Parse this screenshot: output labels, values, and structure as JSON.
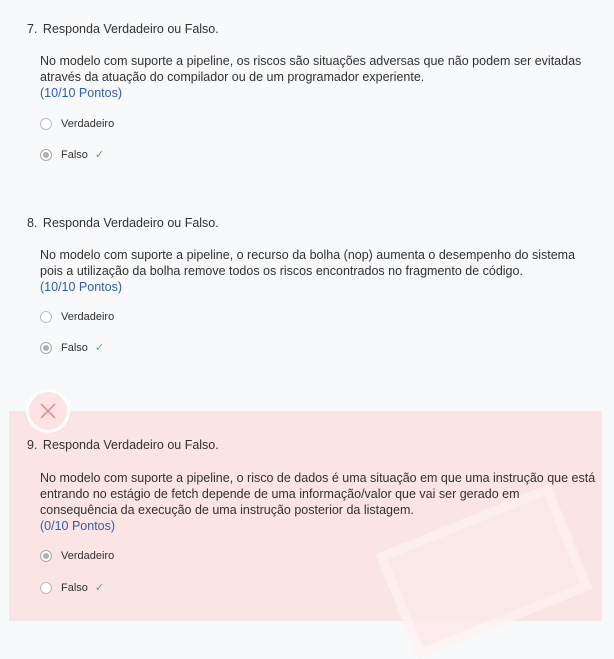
{
  "questions": [
    {
      "number": "7.",
      "title": "Responda Verdadeiro ou Falso.",
      "body": "No modelo com suporte a pipeline, os riscos são situações adversas que não podem ser evitadas através da atuação do compilador ou de um programador experiente.",
      "points": "(10/10 Pontos)",
      "options": [
        {
          "label": "Verdadeiro",
          "selected": false,
          "correct": false
        },
        {
          "label": "Falso",
          "selected": true,
          "correct": true
        }
      ]
    },
    {
      "number": "8.",
      "title": "Responda Verdadeiro ou Falso.",
      "body": "No modelo com suporte a pipeline, o recurso da bolha (nop) aumenta o desempenho do sistema pois a utilização da bolha remove todos os riscos encontrados no fragmento de código.",
      "points": "(10/10 Pontos)",
      "options": [
        {
          "label": "Verdadeiro",
          "selected": false,
          "correct": false
        },
        {
          "label": "Falso",
          "selected": true,
          "correct": true
        }
      ]
    },
    {
      "number": "9.",
      "title": "Responda Verdadeiro ou Falso.",
      "body": "No modelo com suporte a pipeline, o risco de dados é uma situação em que uma instrução que está entrando no estágio de fetch depende de uma informação/valor que vai ser gerado em consequência da execução de uma instrução posterior da listagem.",
      "points": "(0/10 Pontos)",
      "options": [
        {
          "label": "Verdadeiro",
          "selected": true,
          "correct": false
        },
        {
          "label": "Falso",
          "selected": false,
          "correct": true
        }
      ],
      "status": "incorrect"
    }
  ],
  "icons": {
    "correct": "checkmark-icon",
    "incorrect": "x-icon",
    "accent_wrong": "#e88f8f",
    "accent_right": "#5ba36a"
  }
}
